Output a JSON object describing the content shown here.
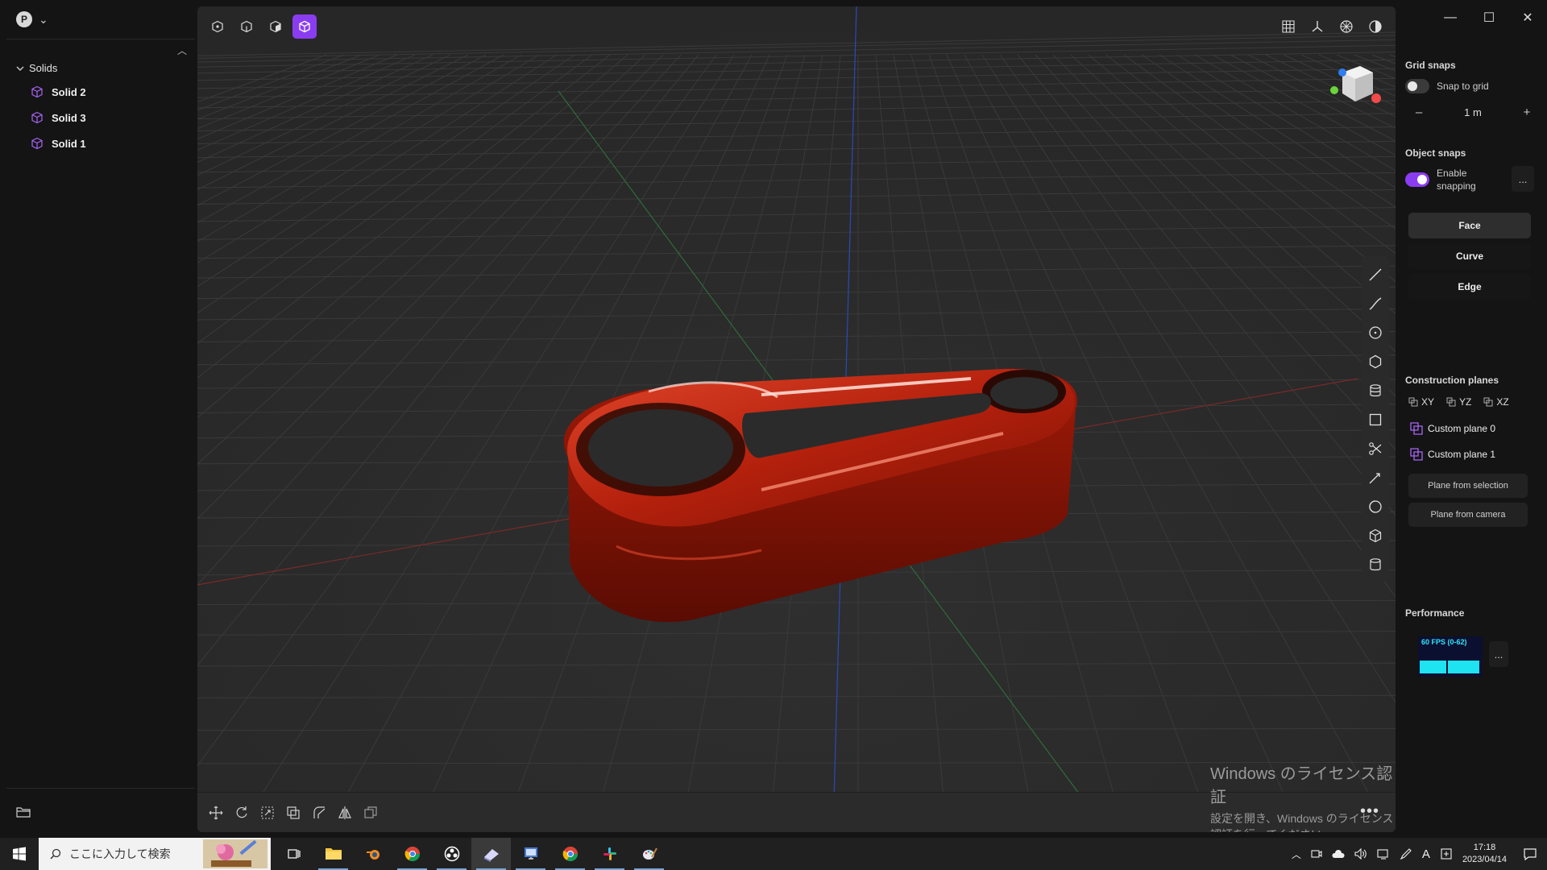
{
  "app": {
    "profile_initial": "P"
  },
  "sidebar": {
    "section_title": "Solids",
    "items": [
      {
        "label": "Solid 2"
      },
      {
        "label": "Solid 3"
      },
      {
        "label": "Solid 1"
      }
    ]
  },
  "viewport": {
    "top_tools": [
      "vertex-select-icon",
      "edge-select-icon",
      "face-select-icon",
      "solid-select-icon"
    ],
    "active_tool": "solid-select-icon",
    "view_tools": [
      "grid-icon",
      "axes-icon",
      "render-mode-icon",
      "shading-icon"
    ],
    "side_tools": [
      "line-icon",
      "curve-icon",
      "circle-icon",
      "polygon-icon",
      "layers-icon",
      "rectangle-icon",
      "cut-icon",
      "pen-icon",
      "sphere-icon",
      "cube-icon",
      "cylinder-icon"
    ],
    "bottom_tools": [
      "move-icon",
      "rotate-icon",
      "scale-icon",
      "boolean-icon",
      "fillet-icon",
      "mirror-icon",
      "duplicate-icon"
    ],
    "model_color": "#c0250f",
    "watermark_title": "Windows のライセンス認証",
    "watermark_sub": "設定を開き、Windows のライセンス認証を行ってください。"
  },
  "right_panel": {
    "grid_snaps_title": "Grid snaps",
    "snap_to_grid_label": "Snap to grid",
    "snap_to_grid_on": false,
    "grid_size": "1 m",
    "object_snaps_title": "Object snaps",
    "enable_snapping_label": "Enable snapping",
    "enable_snapping_on": true,
    "snap_modes": [
      {
        "label": "Face",
        "selected": true
      },
      {
        "label": "Curve",
        "selected": false
      },
      {
        "label": "Edge",
        "selected": false
      }
    ],
    "construction_planes_title": "Construction planes",
    "planes": [
      "XY",
      "YZ",
      "XZ"
    ],
    "custom_planes": [
      "Custom plane 0",
      "Custom plane 1"
    ],
    "plane_from_selection": "Plane from selection",
    "plane_from_camera": "Plane from camera",
    "performance_title": "Performance",
    "fps_label": "60 FPS (0-62)",
    "more": "..."
  },
  "taskbar": {
    "search_placeholder": "ここに入力して検索",
    "time": "17:18",
    "date": "2023/04/14",
    "ime": "A"
  },
  "colors": {
    "accent": "#8a3df0",
    "fps": "#1ee3f0"
  }
}
